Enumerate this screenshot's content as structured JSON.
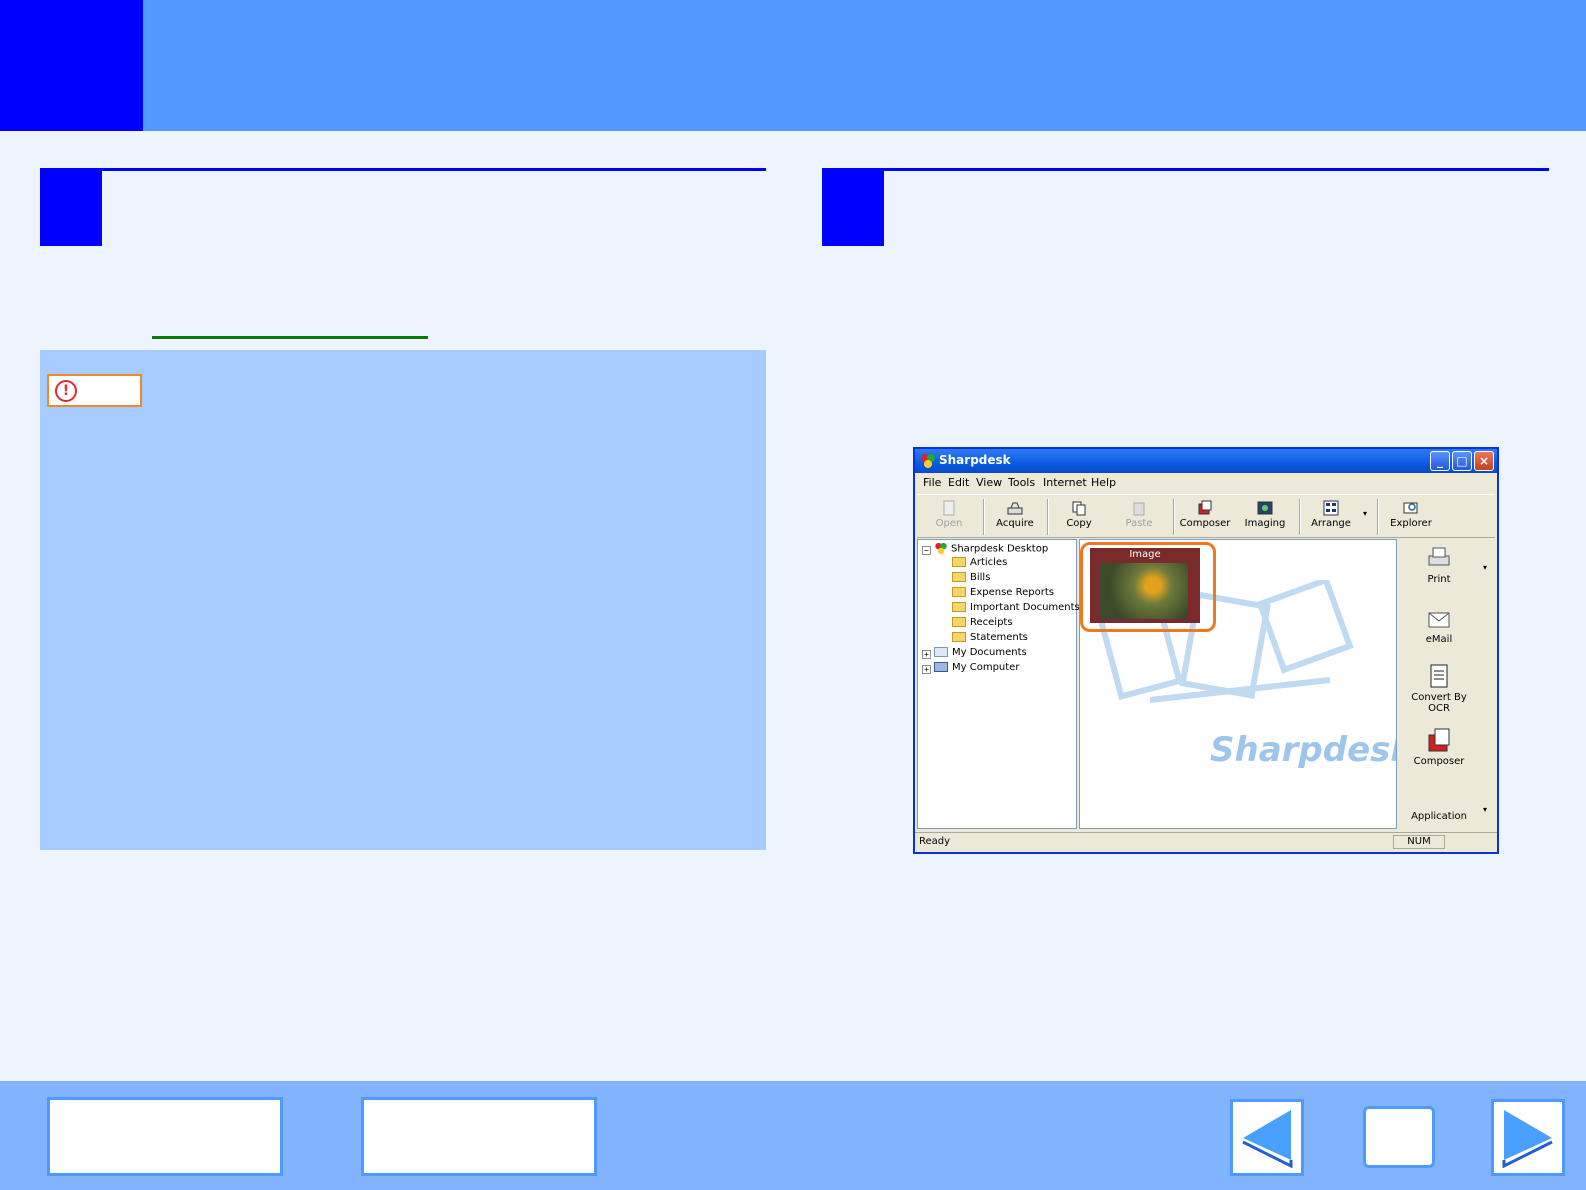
{
  "window": {
    "title": "Sharpdesk",
    "controls": {
      "minimize": "_",
      "maximize": "□",
      "close": "×"
    }
  },
  "menu": [
    "File",
    "Edit",
    "View",
    "Tools",
    "Internet",
    "Help"
  ],
  "toolbar": [
    {
      "label": "Open",
      "icon": "open-icon",
      "enabled": false
    },
    {
      "label": "Acquire",
      "icon": "scanner-icon",
      "enabled": true
    },
    {
      "label": "Copy",
      "icon": "copy-icon",
      "enabled": true
    },
    {
      "label": "Paste",
      "icon": "paste-icon",
      "enabled": false
    },
    {
      "label": "Composer",
      "icon": "composer-icon",
      "enabled": true
    },
    {
      "label": "Imaging",
      "icon": "imaging-icon",
      "enabled": true
    },
    {
      "label": "Arrange",
      "icon": "arrange-icon",
      "enabled": true
    },
    {
      "label": "Explorer",
      "icon": "explorer-icon",
      "enabled": true
    }
  ],
  "tree": {
    "root": "Sharpdesk Desktop",
    "folders": [
      "Articles",
      "Bills",
      "Expense Reports",
      "Important Documents",
      "Receipts",
      "Statements"
    ],
    "other": [
      "My Documents",
      "My Computer"
    ]
  },
  "content": {
    "thumbnail_title": "Image",
    "watermark": "Sharpdesk"
  },
  "side_tools": [
    {
      "label": "Print",
      "icon": "printer-icon"
    },
    {
      "label": "eMail",
      "icon": "email-icon"
    },
    {
      "label": "Convert By OCR",
      "icon": "ocr-icon"
    },
    {
      "label": "Composer",
      "icon": "composer-binder-icon"
    }
  ],
  "side_footer": "Application",
  "status": {
    "text": "Ready",
    "num": "NUM"
  },
  "colors": {
    "header": "#5199ff",
    "accent": "#0000ff",
    "panel": "#a8cbff",
    "footer": "#80b4ff",
    "highlight": "#f07820"
  }
}
